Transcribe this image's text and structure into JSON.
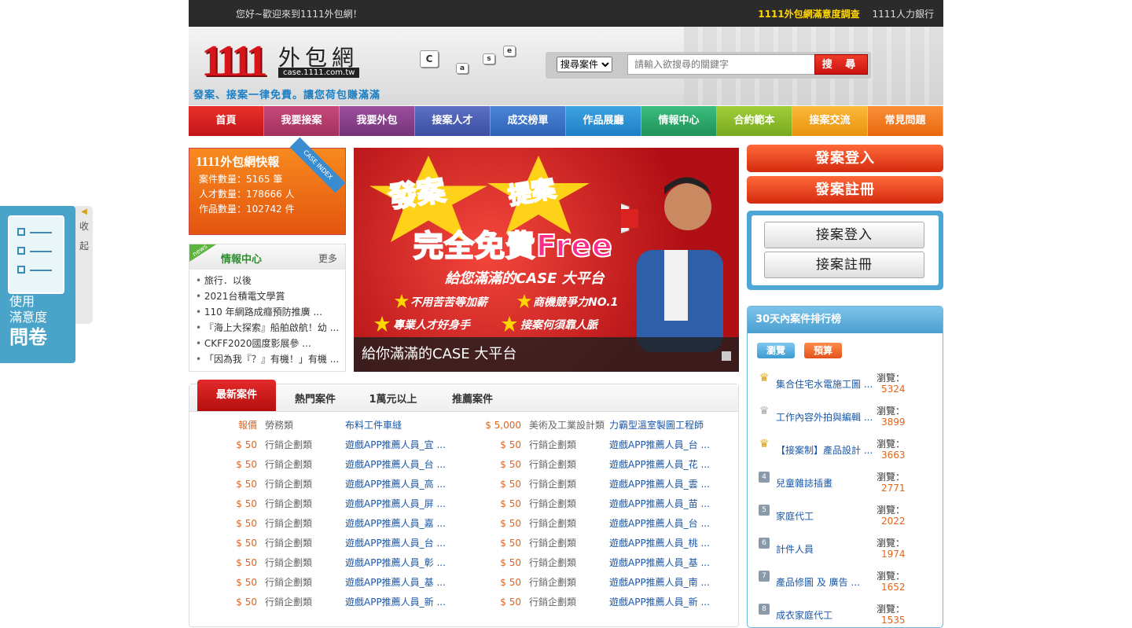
{
  "topbar": {
    "welcome": "您好~歡迎來到1111外包網！",
    "survey": "1111外包網滿意度調查",
    "bank": "1111人力銀行"
  },
  "header": {
    "logo_num": "1111",
    "logo_cn": "外包網",
    "logo_url": "case.1111.com.tw",
    "slogan": "發案、接案一律免費。讓您荷包賺滿滿",
    "keys": [
      "C",
      "a",
      "s",
      "e"
    ]
  },
  "search": {
    "select_value": "搜尋案件",
    "placeholder": "請輸入欲搜尋的關鍵字",
    "button": "搜 尋"
  },
  "nav": [
    {
      "label": "首頁",
      "color": "#d91d1d"
    },
    {
      "label": "我要接案",
      "color": "#b23d6a"
    },
    {
      "label": "我要外包",
      "color": "#8a3d8c"
    },
    {
      "label": "接案人才",
      "color": "#4c5fb3"
    },
    {
      "label": "成交榜單",
      "color": "#3b73c9"
    },
    {
      "label": "作品展廳",
      "color": "#2a8fd6"
    },
    {
      "label": "情報中心",
      "color": "#2aa66b"
    },
    {
      "label": "合約範本",
      "color": "#8bbd2a"
    },
    {
      "label": "接案交流",
      "color": "#f3a11a"
    },
    {
      "label": "常見問題",
      "color": "#f27a1a"
    }
  ],
  "side_survey": {
    "line1": "使用",
    "line2": "滿意度",
    "line3": "問卷",
    "tab1": "收",
    "tab2": "起"
  },
  "news": {
    "brand": "1111",
    "title": "外包網快報",
    "ribbon": "CASE INDEX",
    "stats": [
      "案件數量：5165 筆",
      "人才數量：178666 人",
      "作品數量：102742 件"
    ]
  },
  "info": {
    "badge": "news",
    "title": "情報中心",
    "more": "更多",
    "items": [
      "旅行．以後",
      "2021台積電文學賞",
      "110 年網路成癮預防推廣 ...",
      "『海上大探索』船舶啟航！幼 ...",
      "CKFF2020國度影展參 ...",
      "「因為我『？』有機！」有機 ..."
    ]
  },
  "banner": {
    "w1": "發案",
    "w2": "提案",
    "big": "完全免費Free",
    "sub": "給您滿滿的CASE 大平台",
    "p1": "不用苦苦等加薪",
    "p2": "商機競爭力NO.1",
    "p3": "專業人才好身手",
    "p4": "接案何須靠人脈",
    "caption": "給你滿滿的CASE 大平台"
  },
  "case_tabs": [
    "最新案件",
    "熱門案件",
    "1萬元以上",
    "推薦案件"
  ],
  "cases": [
    [
      {
        "p": "報價",
        "c": "勞務類",
        "t": "布料工件車縫"
      },
      {
        "p": "$ 5,000",
        "c": "美術及工業設計類",
        "t": "力霸型溫室製圖工程師"
      }
    ],
    [
      {
        "p": "$ 50",
        "c": "行銷企劃類",
        "t": "遊戲APP推薦人員_宜 ..."
      },
      {
        "p": "$ 50",
        "c": "行銷企劃類",
        "t": "遊戲APP推薦人員_台 ..."
      }
    ],
    [
      {
        "p": "$ 50",
        "c": "行銷企劃類",
        "t": "遊戲APP推薦人員_台 ..."
      },
      {
        "p": "$ 50",
        "c": "行銷企劃類",
        "t": "遊戲APP推薦人員_花 ..."
      }
    ],
    [
      {
        "p": "$ 50",
        "c": "行銷企劃類",
        "t": "遊戲APP推薦人員_高 ..."
      },
      {
        "p": "$ 50",
        "c": "行銷企劃類",
        "t": "遊戲APP推薦人員_雲 ..."
      }
    ],
    [
      {
        "p": "$ 50",
        "c": "行銷企劃類",
        "t": "遊戲APP推薦人員_屏 ..."
      },
      {
        "p": "$ 50",
        "c": "行銷企劃類",
        "t": "遊戲APP推薦人員_苗 ..."
      }
    ],
    [
      {
        "p": "$ 50",
        "c": "行銷企劃類",
        "t": "遊戲APP推薦人員_嘉 ..."
      },
      {
        "p": "$ 50",
        "c": "行銷企劃類",
        "t": "遊戲APP推薦人員_台 ..."
      }
    ],
    [
      {
        "p": "$ 50",
        "c": "行銷企劃類",
        "t": "遊戲APP推薦人員_台 ..."
      },
      {
        "p": "$ 50",
        "c": "行銷企劃類",
        "t": "遊戲APP推薦人員_桃 ..."
      }
    ],
    [
      {
        "p": "$ 50",
        "c": "行銷企劃類",
        "t": "遊戲APP推薦人員_彰 ..."
      },
      {
        "p": "$ 50",
        "c": "行銷企劃類",
        "t": "遊戲APP推薦人員_基 ..."
      }
    ],
    [
      {
        "p": "$ 50",
        "c": "行銷企劃類",
        "t": "遊戲APP推薦人員_基 ..."
      },
      {
        "p": "$ 50",
        "c": "行銷企劃類",
        "t": "遊戲APP推薦人員_南 ..."
      }
    ],
    [
      {
        "p": "$ 50",
        "c": "行銷企劃類",
        "t": "遊戲APP推薦人員_新 ..."
      },
      {
        "p": "$ 50",
        "c": "行銷企劃類",
        "t": "遊戲APP推薦人員_新 ..."
      }
    ]
  ],
  "login": {
    "post_login": "發案登入",
    "post_register": "發案註冊",
    "take_login": "接案登入",
    "take_register": "接案註冊"
  },
  "rank": {
    "title": "30天內案件排行榜",
    "tab_view": "瀏覽",
    "tab_budget": "預算",
    "view_label": "瀏覽：",
    "items": [
      {
        "no": "1",
        "name": "集合住宅水電施工圖 ...",
        "views": "5324"
      },
      {
        "no": "2",
        "name": "工作內容外拍與編輯 ...",
        "views": "3899"
      },
      {
        "no": "3",
        "name": "【接案制】產品設計 ...",
        "views": "3663"
      },
      {
        "no": "4",
        "name": "兒童雜誌插畫",
        "views": "2771"
      },
      {
        "no": "5",
        "name": "家庭代工",
        "views": "2022"
      },
      {
        "no": "6",
        "name": "計件人員",
        "views": "1974"
      },
      {
        "no": "7",
        "name": "產品修圖 及 廣告 ...",
        "views": "1652"
      },
      {
        "no": "8",
        "name": "成衣家庭代工",
        "views": "1535"
      }
    ]
  }
}
